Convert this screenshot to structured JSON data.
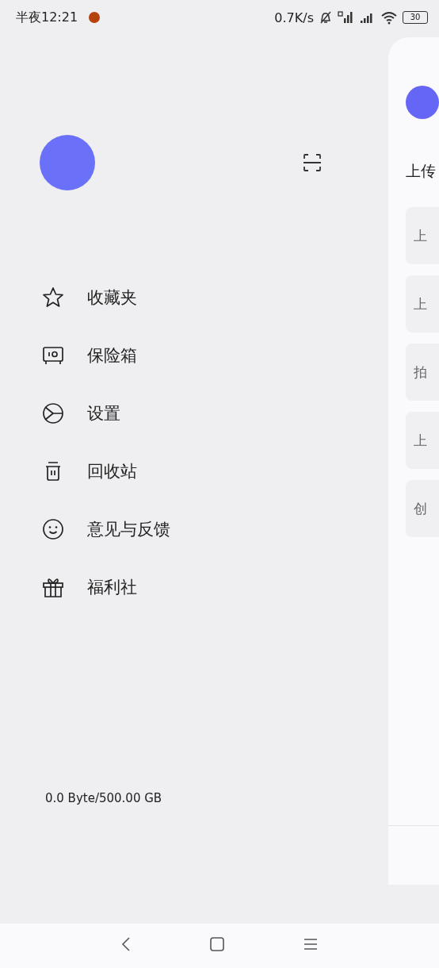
{
  "status_bar": {
    "time": "半夜12:21",
    "network_speed": "0.7K/s",
    "battery": "30"
  },
  "drawer": {
    "menu": [
      {
        "label": "收藏夹"
      },
      {
        "label": "保险箱"
      },
      {
        "label": "设置"
      },
      {
        "label": "回收站"
      },
      {
        "label": "意见与反馈"
      },
      {
        "label": "福利社"
      }
    ],
    "storage": "0.0 Byte/500.00 GB"
  },
  "main_page": {
    "heading": "上传",
    "cards": [
      {
        "label": "上"
      },
      {
        "label": "上"
      },
      {
        "label": "拍"
      },
      {
        "label": "上"
      },
      {
        "label": "创"
      }
    ]
  }
}
